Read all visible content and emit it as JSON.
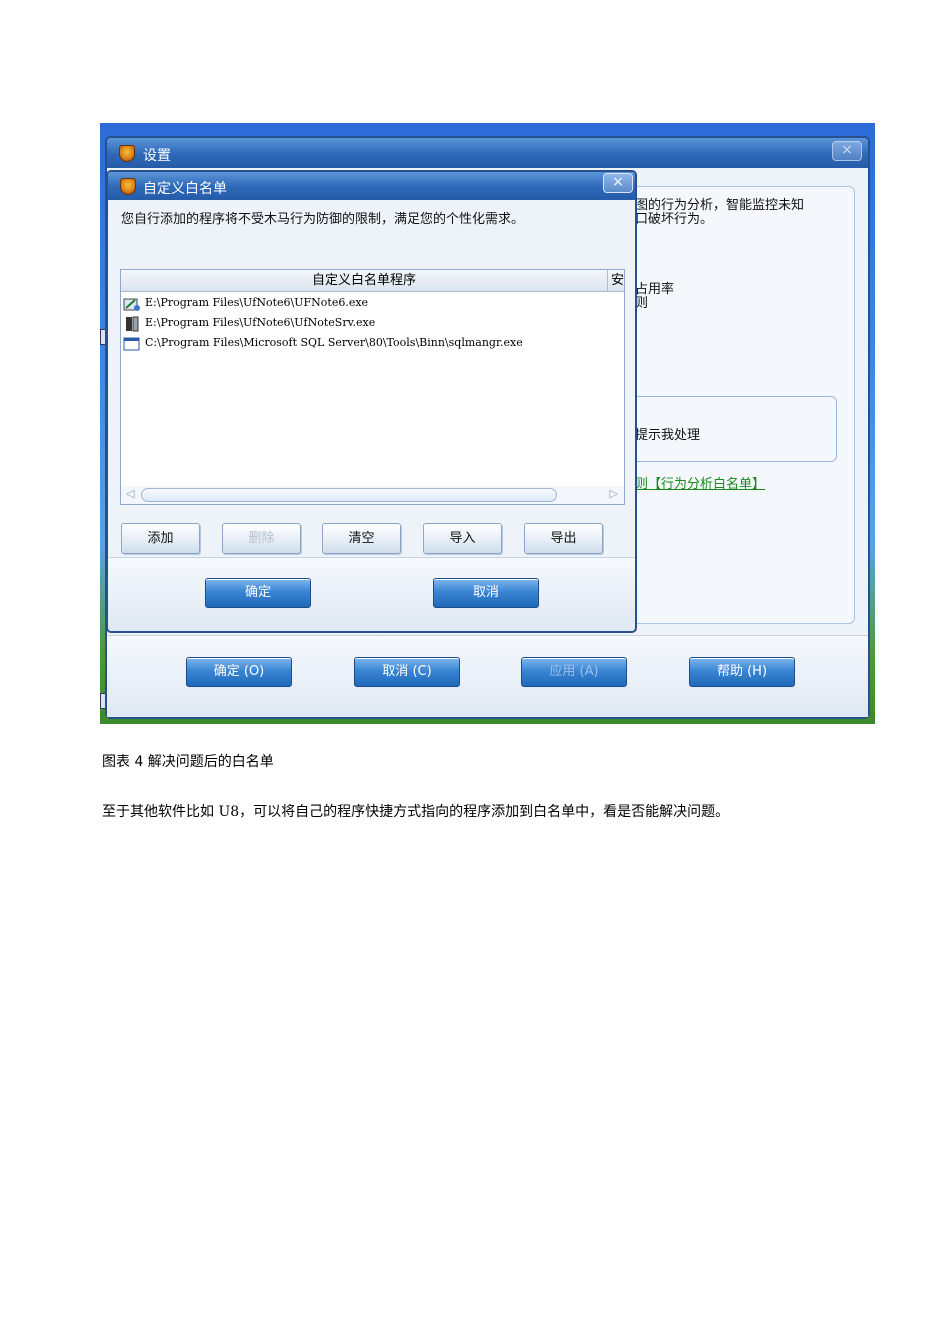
{
  "screenshot": {
    "outer_window": {
      "title": "设置",
      "close_label": "×",
      "bg_texts": {
        "line1": "图的行为分析，智能监控未知",
        "line2": "口破坏行为。",
        "line3": "占用率",
        "line4": "则",
        "line5": "提示我处理"
      },
      "link_text": "【行为分析白名单】",
      "link_prefix": "则",
      "buttons": {
        "ok": "确定 (O)",
        "cancel": "取消 (C)",
        "apply": "应用 (A)",
        "help": "帮助 (H)"
      }
    },
    "whitelist_dialog": {
      "title": "自定义白名单",
      "close_label": "×",
      "description": "您自行添加的程序将不受木马行为防御的限制，满足您的个性化需求。",
      "list": {
        "column_header": "自定义白名单程序",
        "column_header_cut": "安",
        "rows": [
          {
            "path": "E:\\Program Files\\UfNote6\\UFNote6.exe",
            "icon": "app-icon"
          },
          {
            "path": "E:\\Program Files\\UfNote6\\UfNoteSrv.exe",
            "icon": "server-icon"
          },
          {
            "path": "C:\\Program Files\\Microsoft SQL Server\\80\\Tools\\Binn\\sqlmangr.exe",
            "icon": "window-icon"
          }
        ],
        "scroll_left": "◁",
        "scroll_right": "▷"
      },
      "action_buttons": {
        "add": "添加",
        "delete": "删除",
        "clear": "清空",
        "import": "导入",
        "export": "导出"
      },
      "ok_label": "确定",
      "cancel_label": "取消"
    }
  },
  "document": {
    "caption": "图表 4 解决问题后的白名单",
    "paragraph": "至于其他软件比如 U8，可以将自己的程序快捷方式指向的程序添加到白名单中，看是否能解决问题。"
  },
  "colors": {
    "title_bar": "#2d68b8",
    "link_green": "#1a8a1a",
    "button_blue": "#3a86d4"
  }
}
